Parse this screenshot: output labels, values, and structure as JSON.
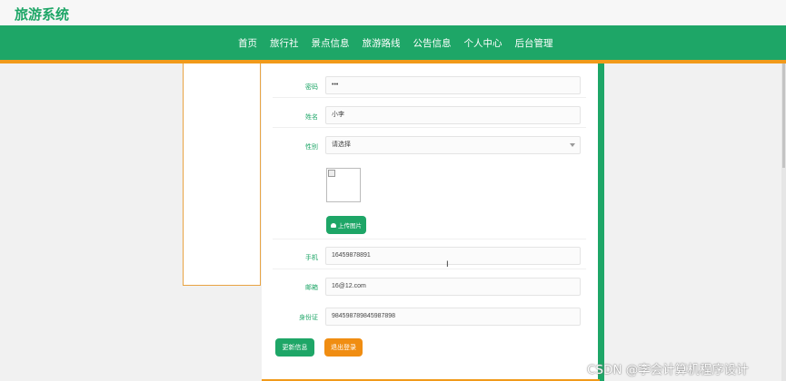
{
  "site": {
    "title": "旅游系统"
  },
  "nav": {
    "items": [
      {
        "label": "首页"
      },
      {
        "label": "旅行社"
      },
      {
        "label": "景点信息"
      },
      {
        "label": "旅游路线"
      },
      {
        "label": "公告信息"
      },
      {
        "label": "个人中心"
      },
      {
        "label": "后台管理"
      }
    ]
  },
  "form": {
    "password": {
      "label": "密码",
      "value": "•••"
    },
    "name": {
      "label": "姓名",
      "value": "小李"
    },
    "gender": {
      "label": "性别",
      "value": "请选择"
    },
    "upload_label": "上传图片",
    "phone": {
      "label": "手机",
      "value": "16459878891"
    },
    "email": {
      "label": "邮箱",
      "value": "16@12.com"
    },
    "id_card": {
      "label": "身份证",
      "value": "984598789845987898"
    }
  },
  "actions": {
    "update_label": "更新信息",
    "logout_label": "退出登录"
  },
  "watermark": "CSDN @李会计算机程序设计",
  "colors": {
    "primary": "#1ea667",
    "accent": "#f19a1a",
    "button_orange": "#f08d12"
  }
}
